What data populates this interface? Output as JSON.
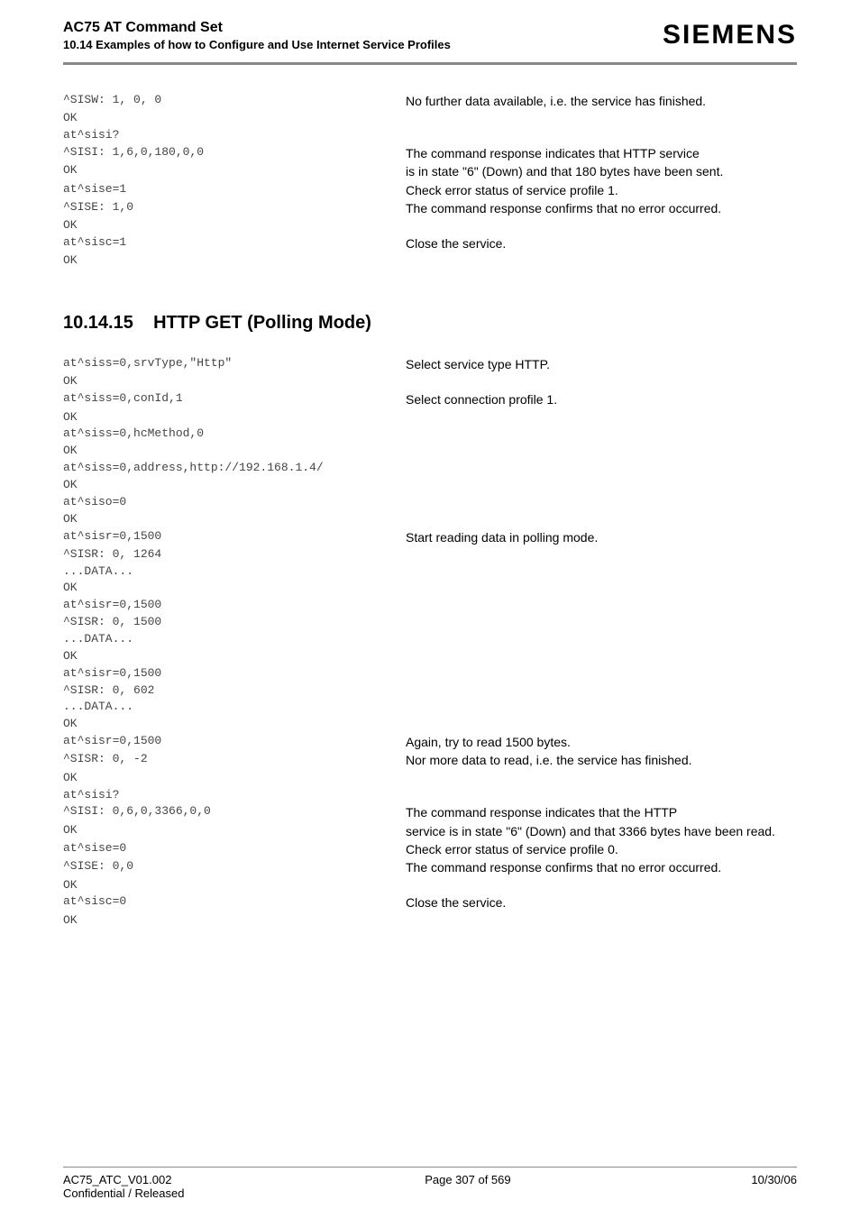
{
  "header": {
    "title": "AC75 AT Command Set",
    "subtitle": "10.14 Examples of how to Configure and Use Internet Service Profiles",
    "logo": "SIEMENS"
  },
  "block1": [
    {
      "l": "^SISW: 1, 0, 0",
      "r": "No further data available, i.e. the service has finished."
    },
    {
      "l": "OK",
      "r": ""
    },
    {
      "l": "at^sisi?",
      "r": ""
    },
    {
      "l": "^SISI: 1,6,0,180,0,0",
      "r": "The command response indicates that HTTP service"
    },
    {
      "l": "OK",
      "r": "is in state \"6\" (Down) and that 180 bytes have been sent."
    },
    {
      "l": "at^sise=1",
      "r": "Check error status of service profile 1."
    },
    {
      "l": "^SISE: 1,0",
      "r": "The command response confirms that no error occurred."
    },
    {
      "l": "OK",
      "r": ""
    },
    {
      "l": "at^sisc=1",
      "r": "Close the service."
    },
    {
      "l": "OK",
      "r": ""
    }
  ],
  "section": {
    "number": "10.14.15",
    "title": "HTTP GET (Polling Mode)"
  },
  "block2": [
    {
      "l": "at^siss=0,srvType,\"Http\"",
      "r": "Select service type HTTP."
    },
    {
      "l": "OK",
      "r": ""
    },
    {
      "l": "at^siss=0,conId,1",
      "r": "Select connection profile 1."
    },
    {
      "l": "OK",
      "r": ""
    },
    {
      "l": "at^siss=0,hcMethod,0",
      "r": ""
    },
    {
      "l": "OK",
      "r": ""
    },
    {
      "l": "at^siss=0,address,http://192.168.1.4/",
      "r": ""
    },
    {
      "l": "OK",
      "r": ""
    },
    {
      "l": "at^siso=0",
      "r": ""
    },
    {
      "l": "OK",
      "r": ""
    },
    {
      "l": "at^sisr=0,1500",
      "r": "Start reading data in polling mode."
    },
    {
      "l": "^SISR: 0, 1264",
      "r": ""
    },
    {
      "l": "...DATA...",
      "r": ""
    },
    {
      "l": "OK",
      "r": ""
    },
    {
      "l": "at^sisr=0,1500",
      "r": ""
    },
    {
      "l": "^SISR: 0, 1500",
      "r": ""
    },
    {
      "l": "...DATA...",
      "r": ""
    },
    {
      "l": "OK",
      "r": ""
    },
    {
      "l": "at^sisr=0,1500",
      "r": ""
    },
    {
      "l": "^SISR: 0, 602",
      "r": ""
    },
    {
      "l": "...DATA...",
      "r": ""
    },
    {
      "l": "OK",
      "r": ""
    },
    {
      "l": "at^sisr=0,1500",
      "r": "Again, try to read 1500 bytes."
    },
    {
      "l": "^SISR: 0, -2",
      "r": "Nor more data to read, i.e. the service has finished."
    },
    {
      "l": "OK",
      "r": ""
    },
    {
      "l": "at^sisi?",
      "r": ""
    },
    {
      "l": "^SISI: 0,6,0,3366,0,0",
      "r": "The command response indicates that the HTTP"
    },
    {
      "l": "OK",
      "r": "service is in state \"6\" (Down) and that 3366 bytes have been read."
    },
    {
      "l": "at^sise=0",
      "r": "Check error status of service profile 0."
    },
    {
      "l": "^SISE: 0,0",
      "r": "The command response confirms that no error occurred."
    },
    {
      "l": "OK",
      "r": ""
    },
    {
      "l": "at^sisc=0",
      "r": "Close the service."
    },
    {
      "l": "OK",
      "r": ""
    }
  ],
  "footer": {
    "left1": "AC75_ATC_V01.002",
    "left2": "Confidential / Released",
    "center": "Page 307 of 569",
    "right": "10/30/06"
  }
}
